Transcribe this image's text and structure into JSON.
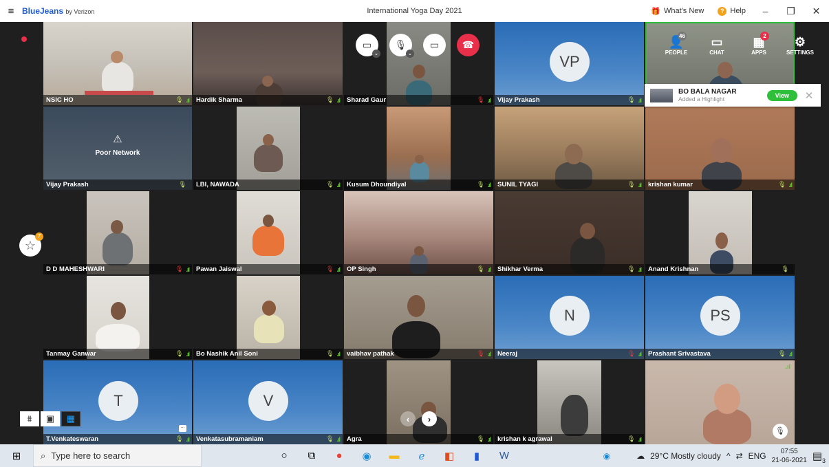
{
  "titlebar": {
    "brand": "BlueJeans",
    "brand_suffix": "by Verizon",
    "meeting_title": "International Yoga Day 2021",
    "whats_new": "What's New",
    "help": "Help"
  },
  "toolbar": {
    "people_label": "PEOPLE",
    "people_count": "46",
    "chat_label": "CHAT",
    "apps_label": "APPS",
    "apps_count": "2",
    "settings_label": "SETTINGS"
  },
  "highlight_toast": {
    "title": "BO BALA NAGAR",
    "subtitle": "Added a Highlight",
    "view_label": "View"
  },
  "poor_network": "Poor Network",
  "highlights_badge": "7",
  "participants": [
    {
      "name": "NSIC HO"
    },
    {
      "name": "Hardik Sharma"
    },
    {
      "name": "Sharad Gaur"
    },
    {
      "name": "Vijay Prakash",
      "initials": "VP"
    },
    {
      "name": ""
    },
    {
      "name": "Vijay Prakash"
    },
    {
      "name": "LBI, NAWADA"
    },
    {
      "name": "Kusum Dhoundiyal"
    },
    {
      "name": "SUNIL TYAGI"
    },
    {
      "name": "krishan kumar"
    },
    {
      "name": "D D MAHESHWARI"
    },
    {
      "name": "Pawan Jaiswal"
    },
    {
      "name": "OP Singh"
    },
    {
      "name": "Shikhar Verma"
    },
    {
      "name": "Anand Krishnan"
    },
    {
      "name": "Tanmay Ganwar"
    },
    {
      "name": "Bo Nashik Anil Soni"
    },
    {
      "name": "vaibhav pathak"
    },
    {
      "name": "Neeraj",
      "initials": "N"
    },
    {
      "name": "Prashant Srivastava",
      "initials": "PS"
    },
    {
      "name": "T.Venkateswaran",
      "initials": "T"
    },
    {
      "name": "Venkatasubramaniam",
      "initials": "V"
    },
    {
      "name": "Agra"
    },
    {
      "name": "krishan k agrawal"
    },
    {
      "name": ""
    }
  ],
  "taskbar": {
    "search_placeholder": "Type here to search",
    "weather": "29°C  Mostly cloudy",
    "lang": "ENG",
    "time": "07:55",
    "date": "21-06-2021",
    "notif_count": "3"
  }
}
